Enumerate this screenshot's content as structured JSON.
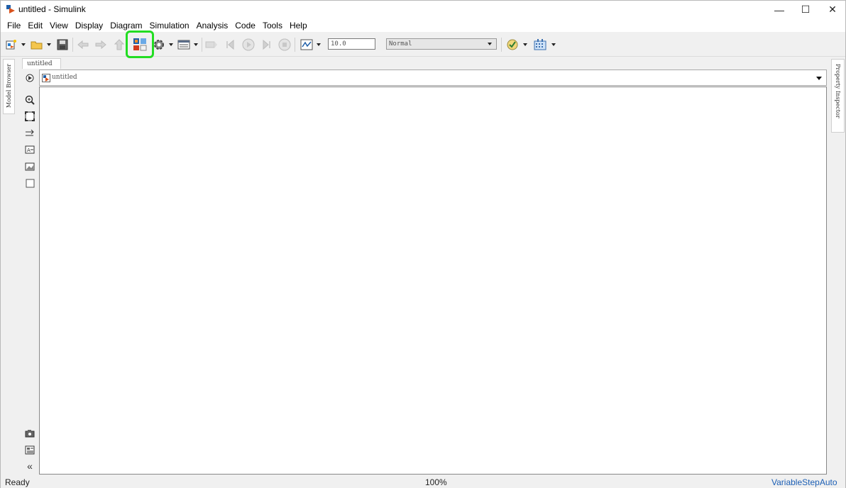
{
  "window": {
    "title": "untitled - Simulink",
    "minimize": "—",
    "maximize": "☐",
    "close": "✕"
  },
  "menu": [
    "File",
    "Edit",
    "View",
    "Display",
    "Diagram",
    "Simulation",
    "Analysis",
    "Code",
    "Tools",
    "Help"
  ],
  "toolbar": {
    "stop_time": "10.0",
    "sim_mode": "Normal",
    "highlight_color": "#22dd22",
    "icons": [
      "new-model-icon",
      "open-icon",
      "save-icon",
      "back-icon",
      "forward-icon",
      "up-icon",
      "library-browser-icon",
      "model-config-icon",
      "model-explorer-icon",
      "step-back-disabled-icon",
      "step-back-icon",
      "run-icon",
      "step-forward-icon",
      "stop-icon",
      "data-inspector-icon",
      "check-icon",
      "build-icon"
    ]
  },
  "side_panels": {
    "model_browser": "Model Browser",
    "property_inspector": "Property Inspector"
  },
  "diagram": {
    "tab_label": "untitled",
    "address": "untitled"
  },
  "status": {
    "left": "Ready",
    "zoom": "100%",
    "solver": "VariableStepAuto"
  }
}
